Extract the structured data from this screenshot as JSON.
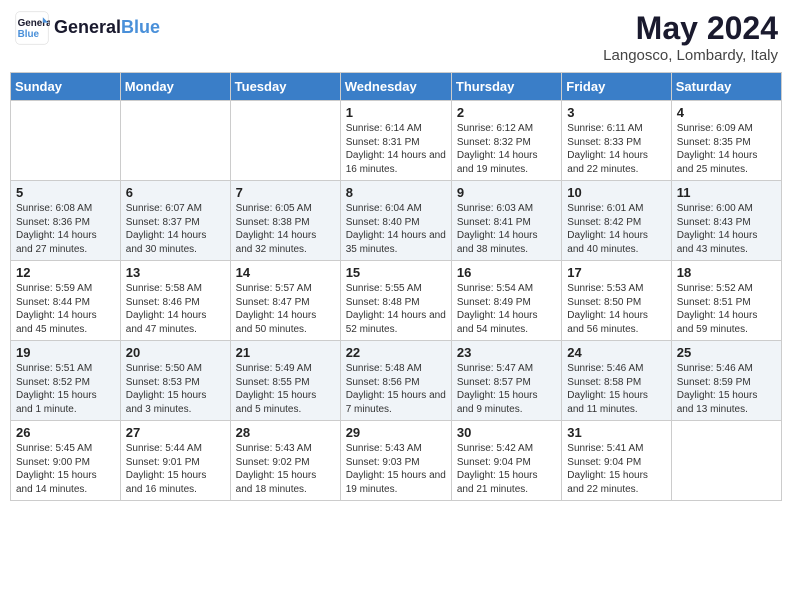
{
  "app": {
    "name": "GeneralBlue",
    "logo_text_line1": "General",
    "logo_text_line2": "Blue"
  },
  "title": {
    "month_year": "May 2024",
    "location": "Langosco, Lombardy, Italy"
  },
  "days_of_week": [
    "Sunday",
    "Monday",
    "Tuesday",
    "Wednesday",
    "Thursday",
    "Friday",
    "Saturday"
  ],
  "weeks": [
    {
      "days": [
        {
          "num": "",
          "content": ""
        },
        {
          "num": "",
          "content": ""
        },
        {
          "num": "",
          "content": ""
        },
        {
          "num": "1",
          "content": "Sunrise: 6:14 AM\nSunset: 8:31 PM\nDaylight: 14 hours and 16 minutes."
        },
        {
          "num": "2",
          "content": "Sunrise: 6:12 AM\nSunset: 8:32 PM\nDaylight: 14 hours and 19 minutes."
        },
        {
          "num": "3",
          "content": "Sunrise: 6:11 AM\nSunset: 8:33 PM\nDaylight: 14 hours and 22 minutes."
        },
        {
          "num": "4",
          "content": "Sunrise: 6:09 AM\nSunset: 8:35 PM\nDaylight: 14 hours and 25 minutes."
        }
      ]
    },
    {
      "days": [
        {
          "num": "5",
          "content": "Sunrise: 6:08 AM\nSunset: 8:36 PM\nDaylight: 14 hours and 27 minutes."
        },
        {
          "num": "6",
          "content": "Sunrise: 6:07 AM\nSunset: 8:37 PM\nDaylight: 14 hours and 30 minutes."
        },
        {
          "num": "7",
          "content": "Sunrise: 6:05 AM\nSunset: 8:38 PM\nDaylight: 14 hours and 32 minutes."
        },
        {
          "num": "8",
          "content": "Sunrise: 6:04 AM\nSunset: 8:40 PM\nDaylight: 14 hours and 35 minutes."
        },
        {
          "num": "9",
          "content": "Sunrise: 6:03 AM\nSunset: 8:41 PM\nDaylight: 14 hours and 38 minutes."
        },
        {
          "num": "10",
          "content": "Sunrise: 6:01 AM\nSunset: 8:42 PM\nDaylight: 14 hours and 40 minutes."
        },
        {
          "num": "11",
          "content": "Sunrise: 6:00 AM\nSunset: 8:43 PM\nDaylight: 14 hours and 43 minutes."
        }
      ]
    },
    {
      "days": [
        {
          "num": "12",
          "content": "Sunrise: 5:59 AM\nSunset: 8:44 PM\nDaylight: 14 hours and 45 minutes."
        },
        {
          "num": "13",
          "content": "Sunrise: 5:58 AM\nSunset: 8:46 PM\nDaylight: 14 hours and 47 minutes."
        },
        {
          "num": "14",
          "content": "Sunrise: 5:57 AM\nSunset: 8:47 PM\nDaylight: 14 hours and 50 minutes."
        },
        {
          "num": "15",
          "content": "Sunrise: 5:55 AM\nSunset: 8:48 PM\nDaylight: 14 hours and 52 minutes."
        },
        {
          "num": "16",
          "content": "Sunrise: 5:54 AM\nSunset: 8:49 PM\nDaylight: 14 hours and 54 minutes."
        },
        {
          "num": "17",
          "content": "Sunrise: 5:53 AM\nSunset: 8:50 PM\nDaylight: 14 hours and 56 minutes."
        },
        {
          "num": "18",
          "content": "Sunrise: 5:52 AM\nSunset: 8:51 PM\nDaylight: 14 hours and 59 minutes."
        }
      ]
    },
    {
      "days": [
        {
          "num": "19",
          "content": "Sunrise: 5:51 AM\nSunset: 8:52 PM\nDaylight: 15 hours and 1 minute."
        },
        {
          "num": "20",
          "content": "Sunrise: 5:50 AM\nSunset: 8:53 PM\nDaylight: 15 hours and 3 minutes."
        },
        {
          "num": "21",
          "content": "Sunrise: 5:49 AM\nSunset: 8:55 PM\nDaylight: 15 hours and 5 minutes."
        },
        {
          "num": "22",
          "content": "Sunrise: 5:48 AM\nSunset: 8:56 PM\nDaylight: 15 hours and 7 minutes."
        },
        {
          "num": "23",
          "content": "Sunrise: 5:47 AM\nSunset: 8:57 PM\nDaylight: 15 hours and 9 minutes."
        },
        {
          "num": "24",
          "content": "Sunrise: 5:46 AM\nSunset: 8:58 PM\nDaylight: 15 hours and 11 minutes."
        },
        {
          "num": "25",
          "content": "Sunrise: 5:46 AM\nSunset: 8:59 PM\nDaylight: 15 hours and 13 minutes."
        }
      ]
    },
    {
      "days": [
        {
          "num": "26",
          "content": "Sunrise: 5:45 AM\nSunset: 9:00 PM\nDaylight: 15 hours and 14 minutes."
        },
        {
          "num": "27",
          "content": "Sunrise: 5:44 AM\nSunset: 9:01 PM\nDaylight: 15 hours and 16 minutes."
        },
        {
          "num": "28",
          "content": "Sunrise: 5:43 AM\nSunset: 9:02 PM\nDaylight: 15 hours and 18 minutes."
        },
        {
          "num": "29",
          "content": "Sunrise: 5:43 AM\nSunset: 9:03 PM\nDaylight: 15 hours and 19 minutes."
        },
        {
          "num": "30",
          "content": "Sunrise: 5:42 AM\nSunset: 9:04 PM\nDaylight: 15 hours and 21 minutes."
        },
        {
          "num": "31",
          "content": "Sunrise: 5:41 AM\nSunset: 9:04 PM\nDaylight: 15 hours and 22 minutes."
        },
        {
          "num": "",
          "content": ""
        }
      ]
    }
  ]
}
